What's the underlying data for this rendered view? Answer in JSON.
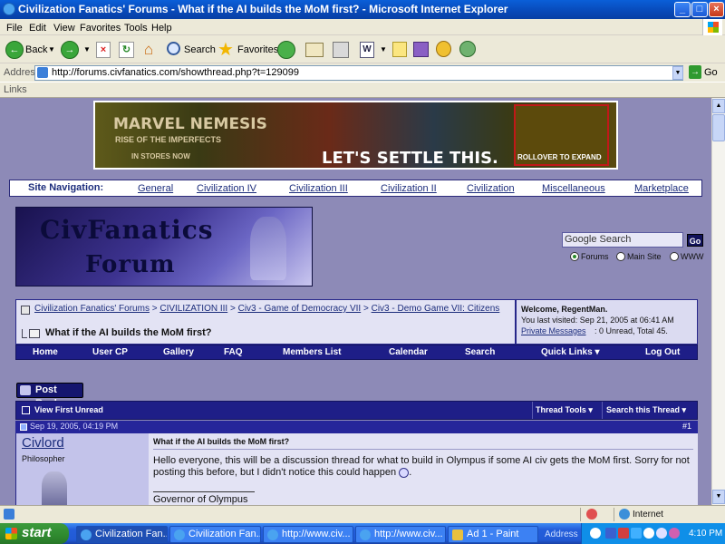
{
  "window": {
    "title": "Civilization Fanatics' Forums - What if the AI builds the MoM first? - Microsoft Internet Explorer"
  },
  "menu": [
    "File",
    "Edit",
    "View",
    "Favorites",
    "Tools",
    "Help"
  ],
  "toolbar": {
    "back": "Back",
    "search": "Search",
    "favorites": "Favorites"
  },
  "address": {
    "label": "Address",
    "url": "http://forums.civfanatics.com/showthread.php?t=129099",
    "go": "Go"
  },
  "links_label": "Links",
  "banner": {
    "title": "MARVEL NEMESIS",
    "subtitle": "RISE OF THE IMPERFECTS",
    "instore": "IN STORES NOW",
    "tagline": "LET'S SETTLE THIS.",
    "rollover": "ROLLOVER TO EXPAND"
  },
  "site_nav": {
    "label": "Site Navigation:",
    "links": [
      "General",
      "Civilization IV",
      "Civilization III",
      "Civilization II",
      "Civilization",
      "Miscellaneous",
      "Marketplace"
    ]
  },
  "logo": {
    "line1": "CivFanatics",
    "line2": "Forum"
  },
  "search": {
    "placeholder": "Google Search",
    "go": "Go",
    "options": [
      "Forums",
      "Main Site",
      "WWW"
    ],
    "selected": "Forums"
  },
  "breadcrumb": {
    "items": [
      "Civilization Fanatics' Forums",
      "CIVILIZATION III",
      "Civ3 - Game of Democracy VII",
      "Civ3 - Demo Game VII: Citizens"
    ],
    "current": "What if the AI builds the MoM first?"
  },
  "welcome": {
    "greeting": "Welcome, RegentMan.",
    "last_visit": "You last visited: Sep 21, 2005 at 06:41 AM",
    "pm_label": "Private Messages",
    "pm_text": ": 0 Unread, Total 45."
  },
  "forum_menu": [
    "Home",
    "User CP",
    "Gallery",
    "FAQ",
    "Members List",
    "Calendar",
    "Search",
    "Quick Links ▾",
    "Log Out"
  ],
  "post_reply": "Post Reply",
  "thread_bar": {
    "view_first": "View First Unread",
    "tools": "Thread Tools ▾",
    "search": "Search this Thread ▾"
  },
  "post": {
    "date": "Sep 19, 2005, 04:19 PM",
    "number": "#1",
    "author": "Civlord",
    "rank": "Philosopher",
    "title": "What if the AI builds the MoM first?",
    "body": "Hello everyone, this will be a discussion thread for what to build in Olympus if some AI civ gets the MoM first. Sorry for not posting this before, but I didn't notice this could happen",
    "signature": "Governor of Olympus"
  },
  "status": {
    "zone": "Internet"
  },
  "taskbar": {
    "start": "start",
    "tasks": [
      "Civilization Fan...",
      "Civilization Fan...",
      "http://www.civ...",
      "http://www.civ...",
      "Ad 1 - Paint"
    ],
    "address": "Address",
    "clock": "4:10 PM"
  },
  "colors": {
    "page_bg": "#8d8ab7",
    "nav_dark": "#1e1e87",
    "light_panel": "#e3e3f4"
  }
}
